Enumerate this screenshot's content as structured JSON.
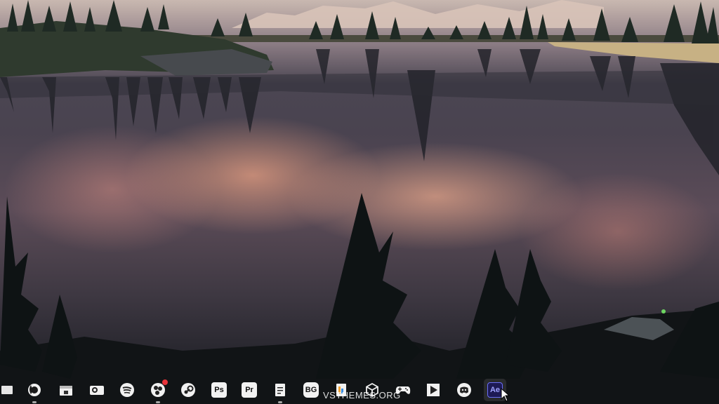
{
  "wallpaper": {
    "description_icon": "landscape-icon"
  },
  "taskbar": {
    "items": [
      {
        "name": "desktop-icon",
        "glyph": ""
      },
      {
        "name": "firefox-icon",
        "glyph": ""
      },
      {
        "name": "file-manager-icon",
        "glyph": ""
      },
      {
        "name": "mail-icon",
        "glyph": ""
      },
      {
        "name": "spotify-icon",
        "glyph": ""
      },
      {
        "name": "obs-icon",
        "glyph": ""
      },
      {
        "name": "steam-icon",
        "glyph": ""
      },
      {
        "name": "photoshop-icon",
        "label": "Ps"
      },
      {
        "name": "premiere-icon",
        "label": "Pr"
      },
      {
        "name": "notes-icon",
        "glyph": ""
      },
      {
        "name": "bg-app-icon",
        "label": "BG"
      },
      {
        "name": "docs-icon",
        "glyph": ""
      },
      {
        "name": "cube-icon",
        "glyph": ""
      },
      {
        "name": "gamepad-icon",
        "glyph": ""
      },
      {
        "name": "media-player-icon",
        "glyph": ""
      },
      {
        "name": "discord-icon",
        "glyph": ""
      },
      {
        "name": "after-effects-icon",
        "label": "Ae"
      }
    ],
    "ps_label": "Ps",
    "pr_label": "Pr",
    "bg_label": "BG",
    "ae_label": "Ae"
  },
  "watermark": "VSTHEMES.ORG",
  "colors": {
    "notification": "#e8333a",
    "ae_bg": "#1d1a55",
    "ae_text": "#9fa3ff"
  }
}
